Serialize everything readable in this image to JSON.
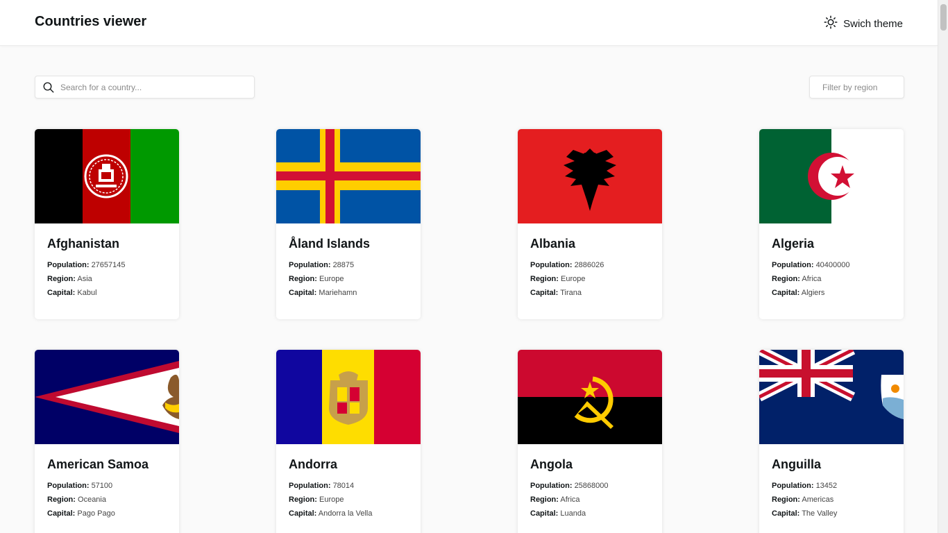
{
  "header": {
    "title": "Countries viewer",
    "theme_toggle_label": "Swich theme"
  },
  "search": {
    "placeholder": "Search for a country..."
  },
  "filter": {
    "label": "Filter by region"
  },
  "labels": {
    "population": "Population:",
    "region": "Region:",
    "capital": "Capital:"
  },
  "countries": [
    {
      "name": "Afghanistan",
      "population": "27657145",
      "region": "Asia",
      "capital": "Kabul",
      "flag": "afghanistan-flag"
    },
    {
      "name": "Åland Islands",
      "population": "28875",
      "region": "Europe",
      "capital": "Mariehamn",
      "flag": "aland-islands-flag"
    },
    {
      "name": "Albania",
      "population": "2886026",
      "region": "Europe",
      "capital": "Tirana",
      "flag": "albania-flag"
    },
    {
      "name": "Algeria",
      "population": "40400000",
      "region": "Africa",
      "capital": "Algiers",
      "flag": "algeria-flag"
    },
    {
      "name": "American Samoa",
      "population": "57100",
      "region": "Oceania",
      "capital": "Pago Pago",
      "flag": "american-samoa-flag"
    },
    {
      "name": "Andorra",
      "population": "78014",
      "region": "Europe",
      "capital": "Andorra la Vella",
      "flag": "andorra-flag"
    },
    {
      "name": "Angola",
      "population": "25868000",
      "region": "Africa",
      "capital": "Luanda",
      "flag": "angola-flag"
    },
    {
      "name": "Anguilla",
      "population": "13452",
      "region": "Americas",
      "capital": "The Valley",
      "flag": "anguilla-flag"
    }
  ]
}
